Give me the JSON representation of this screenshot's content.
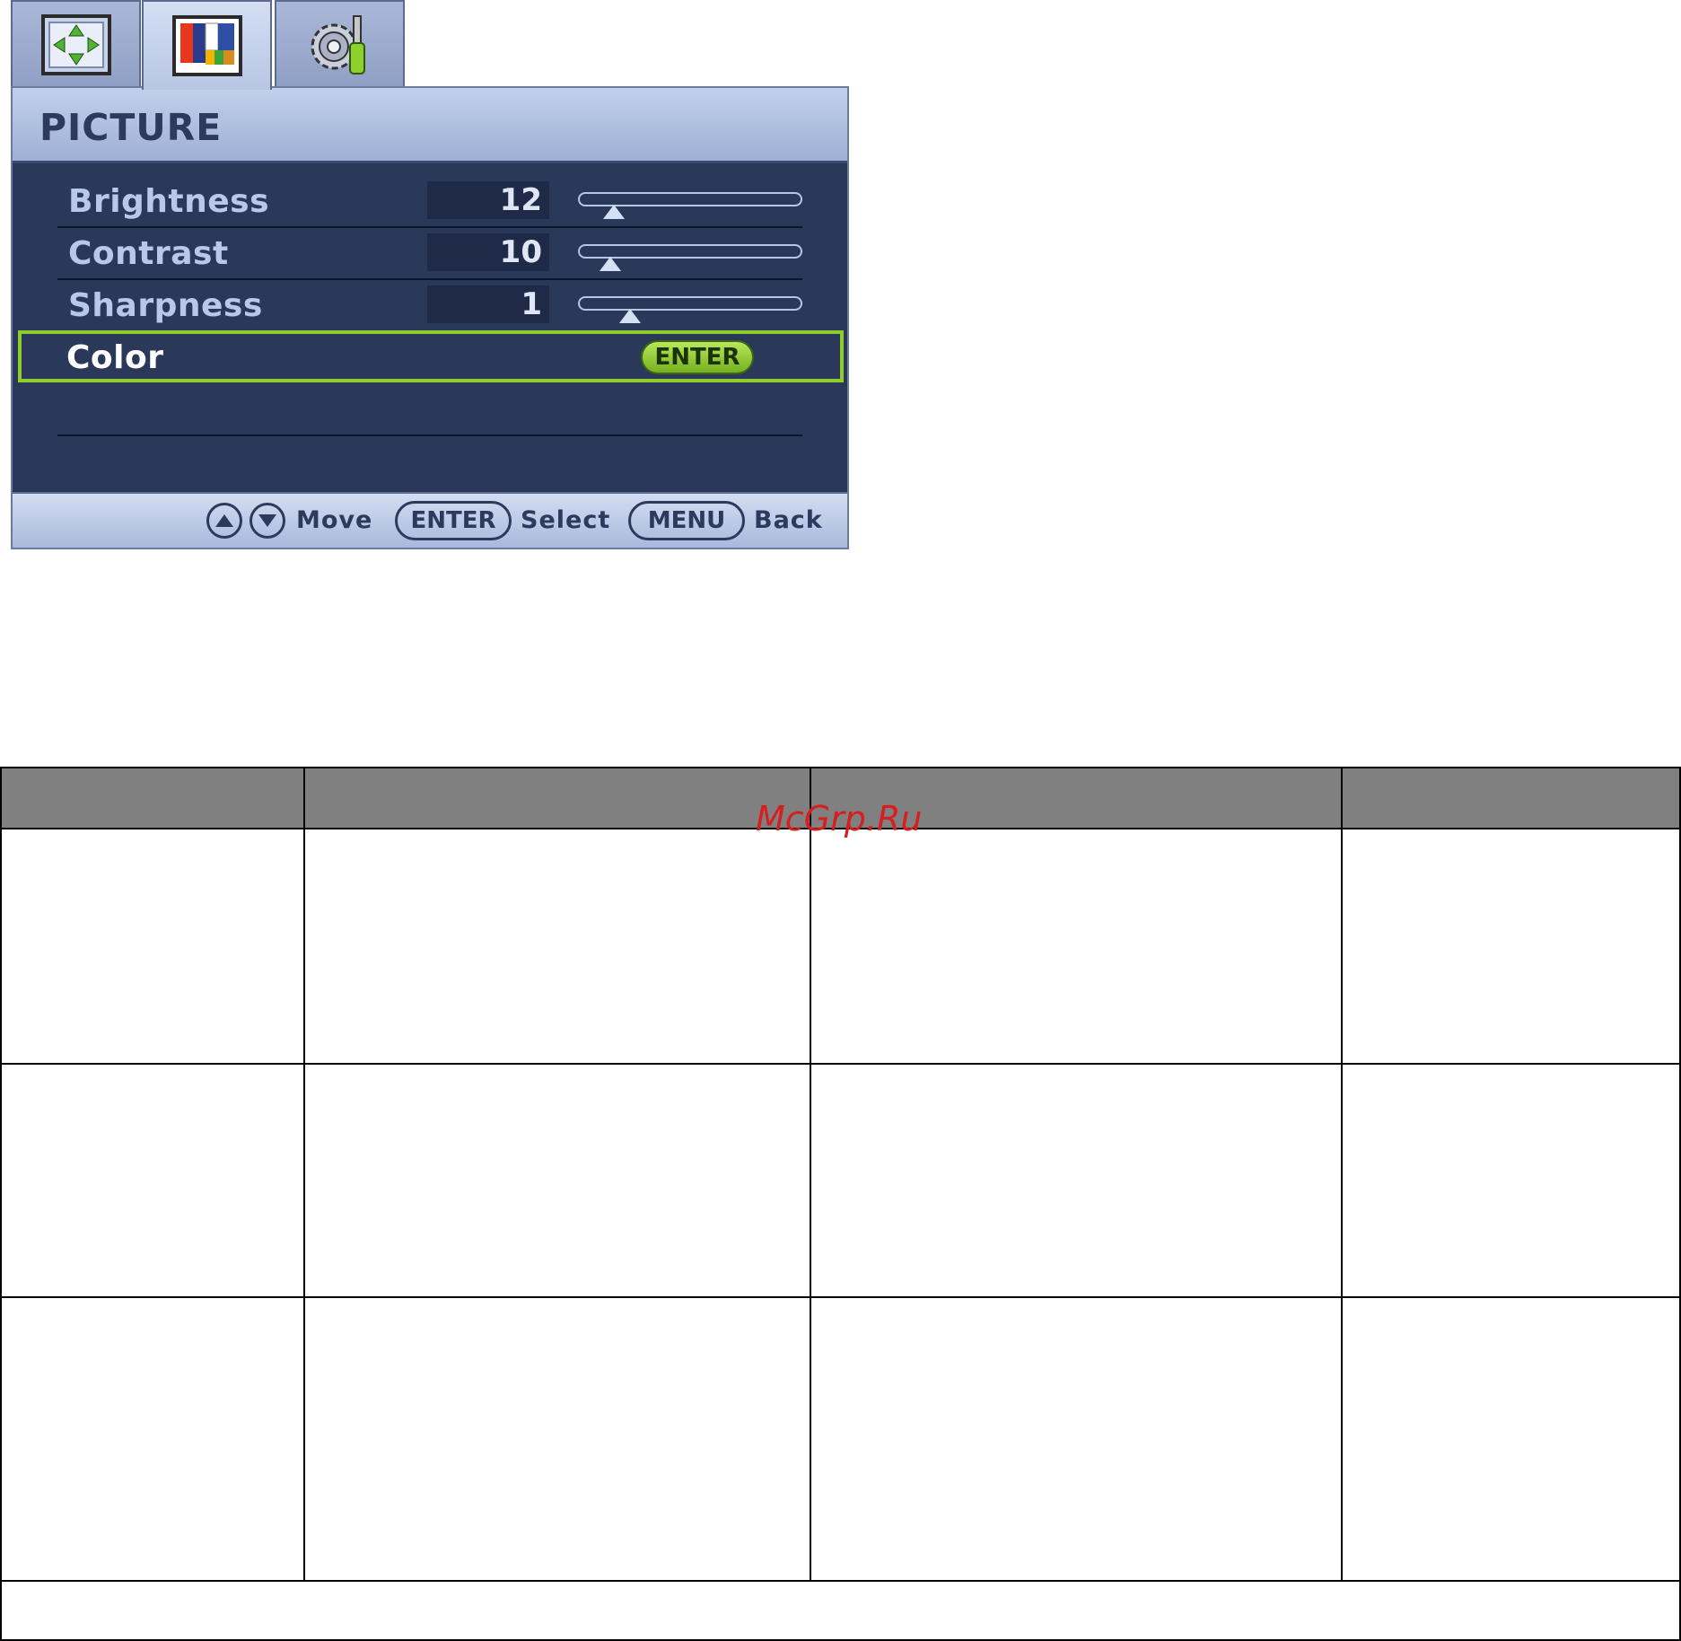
{
  "osd": {
    "tabs": [
      {
        "icon": "display-arrows-icon"
      },
      {
        "icon": "picture-color-bars-icon",
        "active": true
      },
      {
        "icon": "gear-screwdriver-icon"
      }
    ],
    "title": "PICTURE",
    "rows": [
      {
        "label": "Brightness",
        "value": "12",
        "level": 0.12
      },
      {
        "label": "Contrast",
        "value": "10",
        "level": 0.1
      },
      {
        "label": "Sharpness",
        "value": "1",
        "level": 0.2
      }
    ],
    "selected_row": {
      "label": "Color",
      "button": "ENTER"
    },
    "footer": {
      "move_label": "Move",
      "enter_key": "ENTER",
      "select_label": "Select",
      "menu_key": "MENU",
      "back_label": "Back"
    }
  },
  "watermark": "McGrp.Ru",
  "colors": {
    "panel_bg": "#2a385a",
    "highlight": "#8fcc2c",
    "table_header": "#808080"
  }
}
